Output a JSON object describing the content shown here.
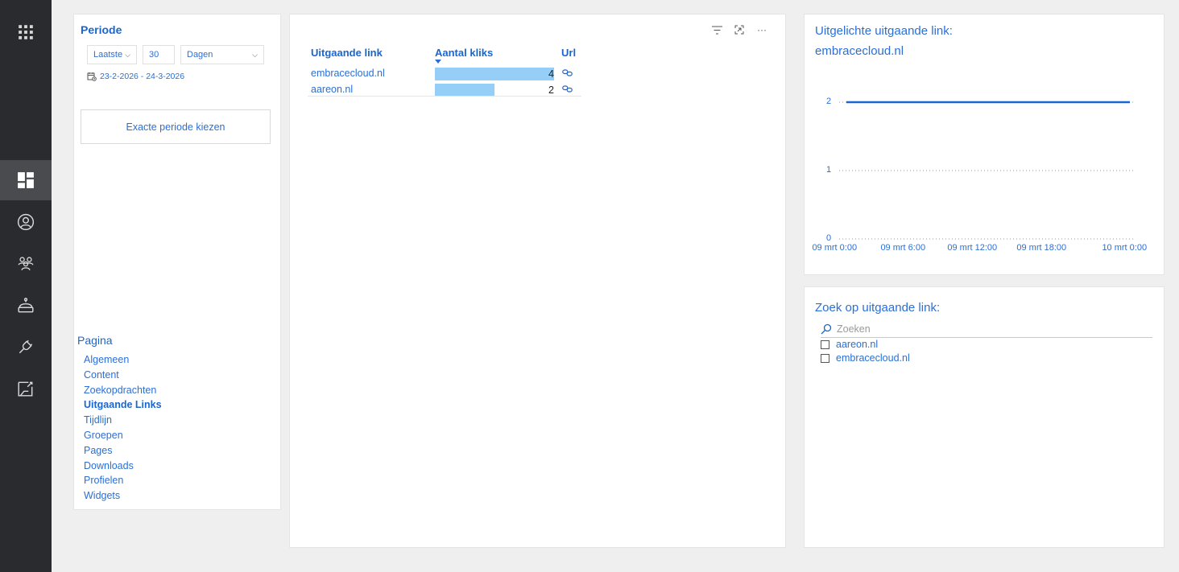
{
  "sidebar": {
    "items": [
      {
        "icon": "apps-grid-icon"
      },
      {
        "icon": "dashboard-icon",
        "active": true
      },
      {
        "icon": "user-circle-icon"
      },
      {
        "icon": "people-group-icon"
      },
      {
        "icon": "robot-icon"
      },
      {
        "icon": "plug-icon"
      },
      {
        "icon": "sticky-note-icon"
      }
    ]
  },
  "filter": {
    "title": "Periode",
    "range_select": "Laatste",
    "range_value": "30",
    "unit_select": "Dagen",
    "date_range": "23-2-2026 - 24-3-2026",
    "exact_button": "Exacte periode kiezen"
  },
  "pages": {
    "title": "Pagina",
    "items": [
      "Algemeen",
      "Content",
      "Zoekopdrachten",
      "Uitgaande Links",
      "Tijdlijn",
      "Groepen",
      "Pages",
      "Downloads",
      "Profielen",
      "Widgets"
    ],
    "current": "Uitgaande Links"
  },
  "table": {
    "columns": [
      "Uitgaande link",
      "Aantal kliks",
      "Url"
    ],
    "rows": [
      {
        "link": "embracecloud.nl",
        "clicks": 4
      },
      {
        "link": "aareon.nl",
        "clicks": 2
      }
    ],
    "max_clicks": 4,
    "bar_color": "#95cff8"
  },
  "featured": {
    "title": "Uitgelichte uitgaande link:",
    "link": "embracecloud.nl",
    "chart_data": {
      "type": "line",
      "yticks": [
        0,
        1,
        2
      ],
      "ylim": [
        0,
        2
      ],
      "xticks": [
        "09 mrt 0:00",
        "09 mrt 6:00",
        "09 mrt 12:00",
        "09 mrt 18:00",
        "10 mrt 0:00"
      ],
      "series": [
        {
          "values": [
            2,
            2
          ]
        }
      ],
      "grid": true,
      "line_color": "#1a66d0"
    }
  },
  "search_panel": {
    "title": "Zoek op uitgaande link:",
    "placeholder": "Zoeken",
    "options": [
      "aareon.nl",
      "embracecloud.nl"
    ]
  }
}
